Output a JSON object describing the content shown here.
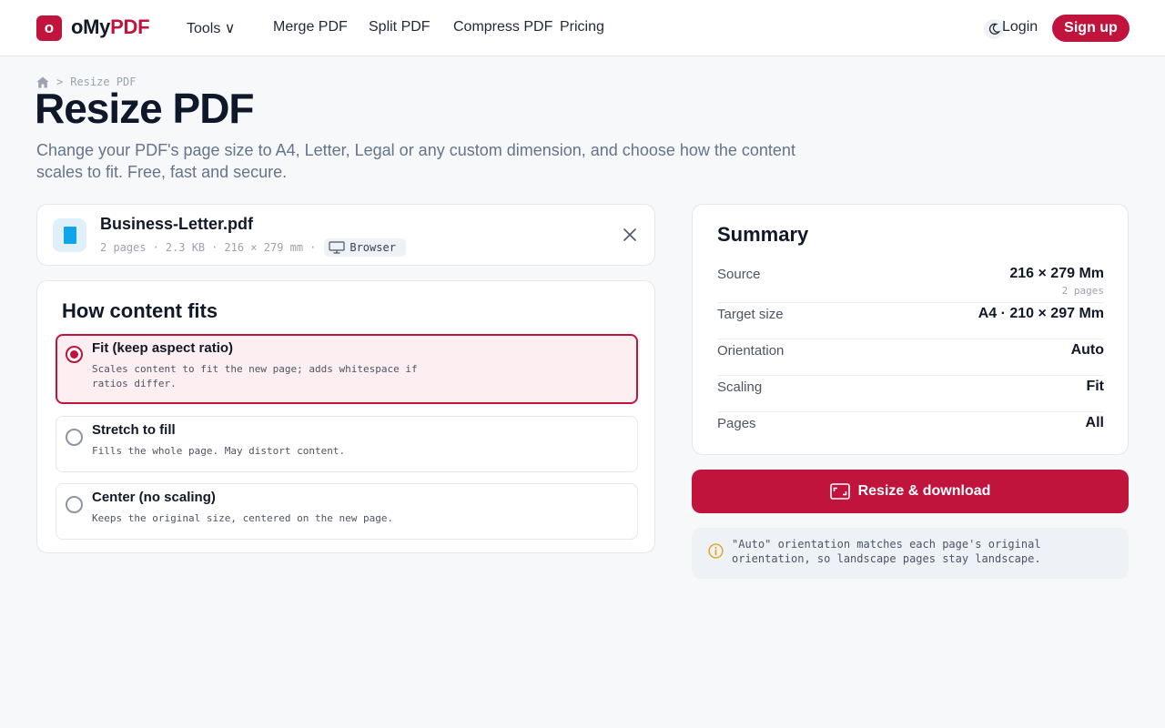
{
  "header": {
    "logo_mark": "o",
    "logo_prefix": "oMy",
    "logo_accent": "PDF",
    "nav": {
      "tools": "Tools ∨",
      "merge": "Merge PDF",
      "split": "Split PDF",
      "compress": "Compress PDF",
      "pricing": "Pricing"
    },
    "login": "Login",
    "signup": "Sign up"
  },
  "breadcrumb": {
    "separator": ">",
    "current": "Resize PDF"
  },
  "page": {
    "title": "Resize PDF",
    "description": "Change your PDF's page size to A4, Letter, Legal or any custom dimension, and choose how the content scales to fit. Free, fast and secure."
  },
  "file": {
    "name": "Business-Letter.pdf",
    "pages": "2 pages",
    "size": "2.3 KB",
    "dimensions": "216 × 279 mm",
    "location": "Browser",
    "dot": "·"
  },
  "fit": {
    "title": "How content fits",
    "options": [
      {
        "label": "Fit (keep aspect ratio)",
        "description": "Scales content to fit the new page; adds whitespace if ratios differ.",
        "selected": true
      },
      {
        "label": "Stretch to fill",
        "description": "Fills the whole page. May distort content.",
        "selected": false
      },
      {
        "label": "Center (no scaling)",
        "description": "Keeps the original size, centered on the new page.",
        "selected": false
      }
    ]
  },
  "summary": {
    "title": "Summary",
    "source_label": "Source",
    "source_value": "216 × 279 Mm",
    "source_sub": "2 pages",
    "target_label": "Target size",
    "target_value": "A4 · 210 × 297 Mm",
    "orientation_label": "Orientation",
    "orientation_value": "Auto",
    "scaling_label": "Scaling",
    "scaling_value": "Fit",
    "pages_label": "Pages",
    "pages_value": "All"
  },
  "download": {
    "label": "Resize & download"
  },
  "note": {
    "text": "\"Auto\" orientation matches each page's original orientation, so landscape pages stay landscape."
  },
  "colors": {
    "accent": "#c0143c",
    "selected_bg": "#fdeef1",
    "file_icon": "#0ea5e9",
    "info_icon": "#e0a21a"
  },
  "icons": {
    "home": "home-icon",
    "theme": "moon-icon",
    "file": "document-icon",
    "browser": "monitor-icon",
    "close": "close-icon",
    "download": "resize-icon",
    "info": "info-icon"
  }
}
